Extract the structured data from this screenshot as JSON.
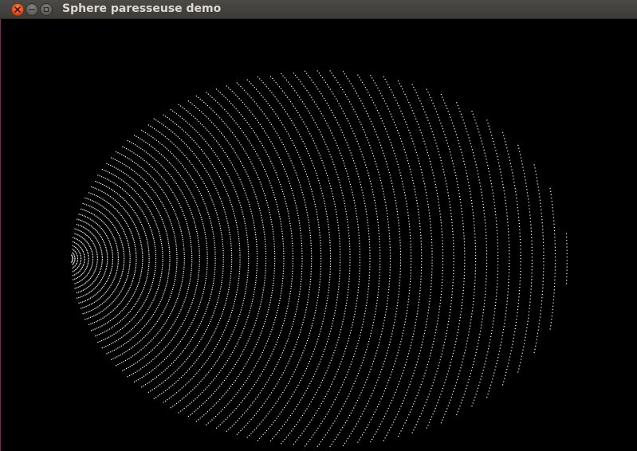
{
  "window": {
    "title": "Sphere paresseuse demo",
    "buttons": {
      "close": "close-icon",
      "minimize": "minimize-icon",
      "maximize": "maximize-icon"
    }
  },
  "colors": {
    "background": "#000000",
    "dots": "#ffffff",
    "close_button": "#e0481a",
    "titlebar": "#3c3b37"
  },
  "canvas": {
    "content": "dotted-sphere-rings"
  }
}
